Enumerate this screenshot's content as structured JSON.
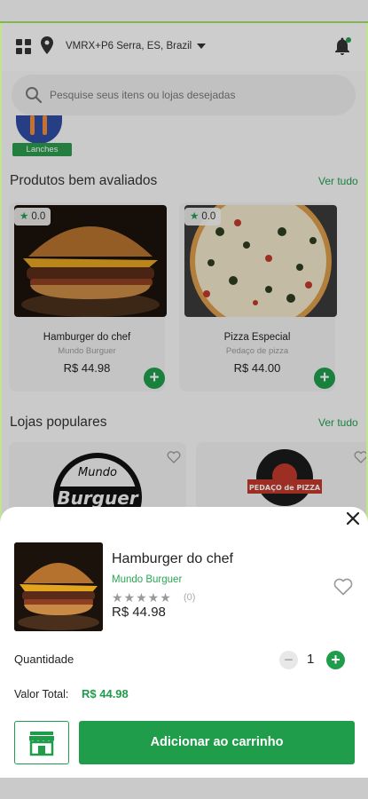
{
  "header": {
    "location": "VMRX+P6 Serra, ES, Brazil",
    "notification_dot_color": "#1f9d4b"
  },
  "search": {
    "placeholder": "Pesquise seus itens ou lojas desejadas"
  },
  "category": {
    "label": "Lanches"
  },
  "top_rated": {
    "title": "Produtos bem avaliados",
    "see_all": "Ver tudo",
    "products": [
      {
        "rating": "0.0",
        "name": "Hamburger do chef",
        "store": "Mundo Burguer",
        "price": "R$ 44.98",
        "add": "+"
      },
      {
        "rating": "0.0",
        "name": "Pizza Especial",
        "store": "Pedaço de pizza",
        "price": "R$ 44.00",
        "add": "+"
      }
    ]
  },
  "popular_stores": {
    "title": "Lojas populares",
    "see_all": "Ver tudo",
    "stores": [
      {
        "logo_text": "Mundo",
        "logo_text_2": "Burguer"
      },
      {
        "logo_text": "PEDAÇO de PIZZA"
      }
    ]
  },
  "sheet": {
    "product_name": "Hamburger do chef",
    "store_name": "Mundo Burguer",
    "stars": "★★★★★",
    "reviews": "(0)",
    "price": "R$ 44.98",
    "quantity_label": "Quantidade",
    "quantity": "1",
    "minus": "−",
    "plus": "+",
    "total_label": "Valor Total:",
    "total_value": "R$ 44.98",
    "cart_button": "Adicionar ao carrinho"
  },
  "colors": {
    "accent": "#1f9d4b",
    "edge": "#a6d96a"
  }
}
